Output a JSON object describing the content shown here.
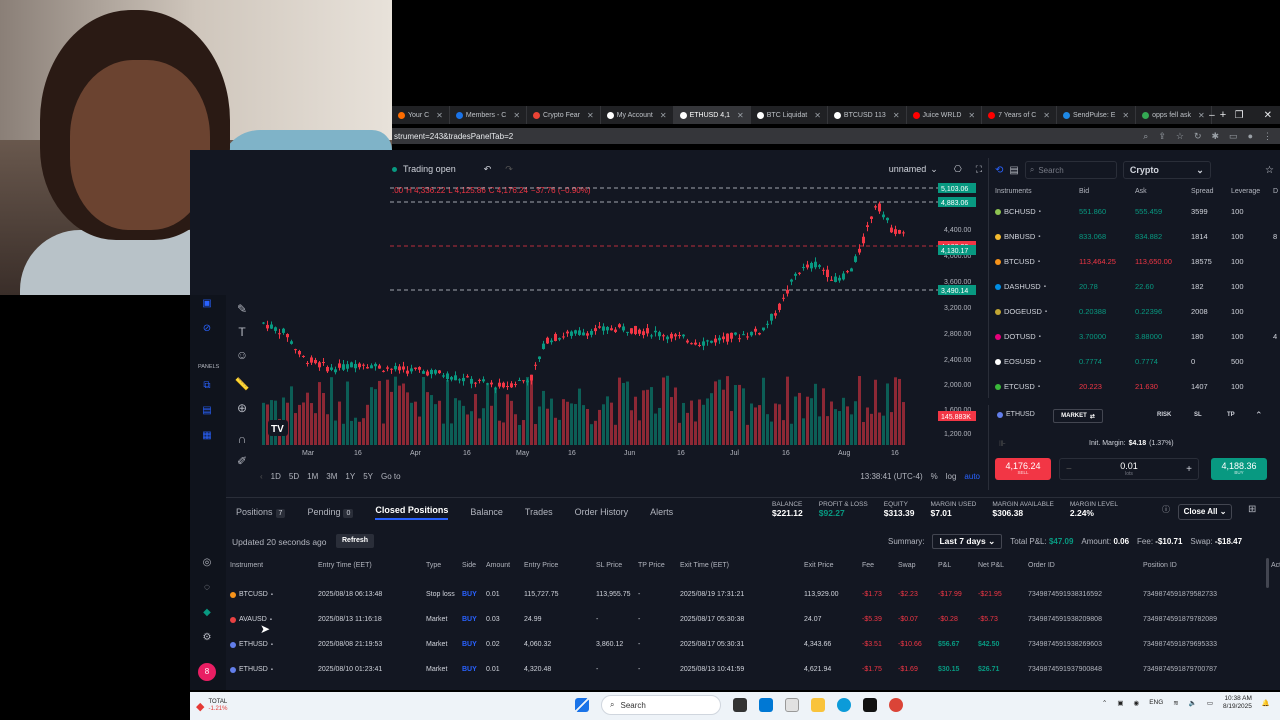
{
  "browser": {
    "tabs": [
      {
        "label": "Your C",
        "color": "#ff6d00"
      },
      {
        "label": "Members - C",
        "color": "#1a73e8"
      },
      {
        "label": "Crypto Fear",
        "color": "#ea4335"
      },
      {
        "label": "My Account",
        "color": "#ffffff"
      },
      {
        "label": "ETHUSD 4,1",
        "color": "#ffffff",
        "active": true
      },
      {
        "label": "BTC Liquidat",
        "color": "#ffffff"
      },
      {
        "label": "BTCUSD 113",
        "color": "#ffffff"
      },
      {
        "label": "Juice WRLD",
        "color": "#ff0000"
      },
      {
        "label": "7 Years of C",
        "color": "#ff0000"
      },
      {
        "label": "SendPulse: E",
        "color": "#1e88e5"
      },
      {
        "label": "opps fell ask",
        "color": "#34a853"
      }
    ],
    "new_tab": "+",
    "url": "strument=243&tradesPanelTab=2",
    "window_controls": {
      "minimize": "–",
      "restore": "❐",
      "close": "✕"
    }
  },
  "chart_header": {
    "status": "Trading open",
    "layout_name": "unnamed",
    "ohlc": {
      "o": ".00",
      "h": "H 4,336.22",
      "l": "L 4,125.86",
      "c": "C 4,176.24",
      "chg": "−37.76 (−0.90%)"
    }
  },
  "price_axis": {
    "labels": [
      "4,400.00",
      "4,000.00",
      "3,600.00",
      "3,200.00",
      "2,800.00",
      "2,400.00",
      "2,000.00",
      "1,600.00",
      "1,200.00"
    ],
    "tags": [
      {
        "text": "5,103.06",
        "color": "#089981"
      },
      {
        "text": "4,883.06",
        "color": "#089981"
      },
      {
        "text": "4,188.36",
        "color": "#f23645"
      },
      {
        "text": "4,130.17",
        "color": "#089981"
      },
      {
        "text": "3,490.14",
        "color": "#089981"
      },
      {
        "text": "145.883K",
        "color": "#f23645"
      }
    ]
  },
  "time_axis": {
    "labels": [
      "Mar",
      "16",
      "Apr",
      "16",
      "May",
      "16",
      "Jun",
      "16",
      "Jul",
      "16",
      "Aug",
      "16"
    ]
  },
  "range_bar": {
    "ranges": [
      "1D",
      "5D",
      "1M",
      "3M",
      "1Y",
      "5Y"
    ],
    "goto": "Go to",
    "clock": "13:38:41 (UTC-4)",
    "pct": "%",
    "log": "log",
    "auto": "auto"
  },
  "left_panel": {
    "panels_label": "PANELS"
  },
  "instruments": {
    "search_placeholder": "Search",
    "category": "Crypto",
    "columns": [
      "Instruments",
      "Bid",
      "Ask",
      "Spread",
      "Leverage",
      "D"
    ],
    "rows": [
      {
        "symbol": "BCHUSD",
        "bid": "551.860",
        "ask": "555.459",
        "spread": "3599",
        "leverage": "100",
        "d": "",
        "color": "#8dc351"
      },
      {
        "symbol": "BNBUSD",
        "bid": "833.068",
        "ask": "834.882",
        "spread": "1814",
        "leverage": "100",
        "d": "8",
        "color": "#f3ba2f"
      },
      {
        "symbol": "BTCUSD",
        "bid": "113,464.25",
        "ask": "113,650.00",
        "spread": "18575",
        "leverage": "100",
        "d": "",
        "color": "#f7931a",
        "down": true
      },
      {
        "symbol": "DASHUSD",
        "bid": "20.78",
        "ask": "22.60",
        "spread": "182",
        "leverage": "100",
        "d": "",
        "color": "#008de4"
      },
      {
        "symbol": "DOGEUSD",
        "bid": "0.20388",
        "ask": "0.22396",
        "spread": "2008",
        "leverage": "100",
        "d": "",
        "color": "#c2a633"
      },
      {
        "symbol": "DOTUSD",
        "bid": "3.70000",
        "ask": "3.88000",
        "spread": "180",
        "leverage": "100",
        "d": "4",
        "color": "#e6007a"
      },
      {
        "symbol": "EOSUSD",
        "bid": "0.7774",
        "ask": "0.7774",
        "spread": "0",
        "leverage": "500",
        "d": "",
        "color": "#ffffff"
      },
      {
        "symbol": "ETCUSD",
        "bid": "20.223",
        "ask": "21.630",
        "spread": "1407",
        "leverage": "100",
        "d": "",
        "color": "#3ab83a",
        "down": true
      }
    ]
  },
  "order_panel": {
    "symbol": "ETHUSD",
    "type": "MARKET",
    "risk": "RISK",
    "sl": "SL",
    "tp": "TP",
    "init_margin": "Init. Margin:",
    "init_margin_value": "$4.18",
    "init_margin_pct": "(1.37%)",
    "sell_price": "4,176.24",
    "sell_label": "SELL",
    "buy_price": "4,188.36",
    "buy_label": "BUY",
    "qty": "0.01",
    "qty_unit": "lots",
    "minus": "−",
    "plus": "+"
  },
  "bottom": {
    "tabs": [
      {
        "label": "Positions",
        "badge": "7"
      },
      {
        "label": "Pending",
        "badge": "0"
      },
      {
        "label": "Closed Positions",
        "badge": "",
        "active": true
      },
      {
        "label": "Balance",
        "badge": ""
      },
      {
        "label": "Trades",
        "badge": ""
      },
      {
        "label": "Order History",
        "badge": ""
      },
      {
        "label": "Alerts",
        "badge": ""
      }
    ],
    "stats": [
      {
        "k": "BALANCE",
        "v": "$221.12",
        "g": false
      },
      {
        "k": "PROFIT & LOSS",
        "v": "$92.27",
        "g": true
      },
      {
        "k": "EQUITY",
        "v": "$313.39",
        "g": false
      },
      {
        "k": "MARGIN USED",
        "v": "$7.01",
        "g": false
      },
      {
        "k": "MARGIN AVAILABLE",
        "v": "$306.38",
        "g": false
      },
      {
        "k": "MARGIN LEVEL",
        "v": "2.24%",
        "g": false
      }
    ],
    "close_all": "Close All",
    "updated": "Updated 20 seconds ago",
    "refresh": "Refresh",
    "summary_label": "Summary:",
    "summary_period": "Last 7 days",
    "total_pl_label": "Total P&L:",
    "total_pl": "$47.09",
    "amount_label": "Amount:",
    "amount": "0.06",
    "fee_label": "Fee:",
    "fee": "-$10.71",
    "swap_label": "Swap:",
    "swap": "-$18.47",
    "columns": [
      "Instrument",
      "Entry Time (EET)",
      "Type",
      "Side",
      "Amount",
      "Entry Price",
      "SL Price",
      "TP Price",
      "Exit Time (EET)",
      "Exit Price",
      "Fee",
      "Swap",
      "P&L",
      "Net P&L",
      "Order ID",
      "Position ID",
      "Actions"
    ],
    "rows": [
      {
        "instrument": "BTCUSD",
        "color": "#f7931a",
        "entry_time": "2025/08/18 06:13:48",
        "type": "Stop loss",
        "side": "BUY",
        "amount": "0.01",
        "entry_price": "115,727.75",
        "sl": "113,955.75",
        "tp": "-",
        "exit_time": "2025/08/19 17:31:21",
        "exit_price": "113,929.00",
        "fee": "-$1.73",
        "swap": "-$2.23",
        "pl": "-$17.99",
        "net": "-$21.95",
        "order_id": "7349874591938316592",
        "position_id": "7349874591879582733",
        "pos": false
      },
      {
        "instrument": "AVAUSD",
        "color": "#e84142",
        "entry_time": "2025/08/13 11:16:18",
        "type": "Market",
        "side": "BUY",
        "amount": "0.03",
        "entry_price": "24.99",
        "sl": "-",
        "tp": "-",
        "exit_time": "2025/08/17 05:30:38",
        "exit_price": "24.07",
        "fee": "-$5.39",
        "swap": "-$0.07",
        "pl": "-$0.28",
        "net": "-$5.73",
        "order_id": "7349874591938209808",
        "position_id": "7349874591879782089",
        "pos": false
      },
      {
        "instrument": "ETHUSD",
        "color": "#627eea",
        "entry_time": "2025/08/08 21:19:53",
        "type": "Market",
        "side": "BUY",
        "amount": "0.02",
        "entry_price": "4,060.32",
        "sl": "3,860.12",
        "tp": "-",
        "exit_time": "2025/08/17 05:30:31",
        "exit_price": "4,343.66",
        "fee": "-$3.51",
        "swap": "-$10.66",
        "pl": "$56.67",
        "net": "$42.50",
        "order_id": "7349874591938269603",
        "position_id": "7349874591879695333",
        "pos": true
      },
      {
        "instrument": "ETHUSD",
        "color": "#627eea",
        "entry_time": "2025/08/10 01:23:41",
        "type": "Market",
        "side": "BUY",
        "amount": "0.01",
        "entry_price": "4,320.48",
        "sl": "-",
        "tp": "-",
        "exit_time": "2025/08/13 10:41:59",
        "exit_price": "4,621.94",
        "fee": "-$1.75",
        "swap": "-$1.69",
        "pl": "$30.15",
        "net": "$26.71",
        "order_id": "7349874591937900848",
        "position_id": "7349874591879700787",
        "pos": true
      }
    ]
  },
  "taskbar": {
    "total_label": "TOTAL",
    "total_value": "-1.21%",
    "search": "Search",
    "lang": "ENG",
    "time": "10:38 AM",
    "date": "8/19/2025"
  },
  "colors": {
    "up": "#089981",
    "down": "#f23645",
    "accent": "#2962ff"
  }
}
